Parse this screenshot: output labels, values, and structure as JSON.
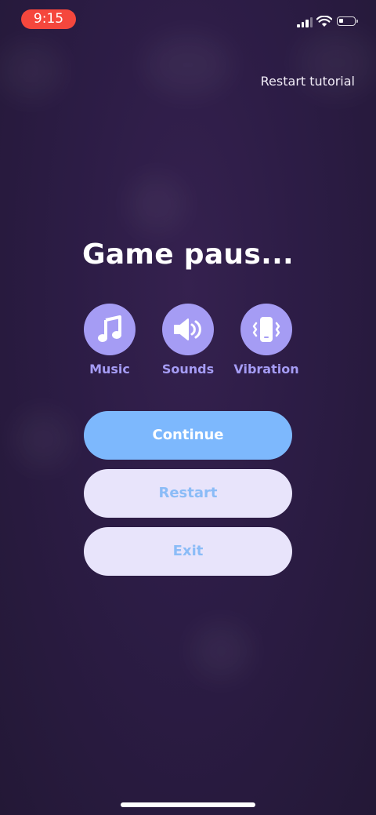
{
  "status_bar": {
    "time": "9:15",
    "time_pill_color": "#f5473d",
    "icons": [
      "cellular-signal-icon",
      "wifi-icon",
      "battery-icon"
    ]
  },
  "header": {
    "restart_tutorial": "Restart tutorial"
  },
  "pause_menu": {
    "title": "Game paus...",
    "toggles": [
      {
        "label": "Music",
        "icon": "music-note-icon"
      },
      {
        "label": "Sounds",
        "icon": "speaker-icon"
      },
      {
        "label": "Vibration",
        "icon": "phone-vibrate-icon"
      }
    ],
    "buttons": {
      "continue": "Continue",
      "restart": "Restart",
      "exit": "Exit"
    }
  },
  "colors": {
    "background": "#2c1c45",
    "toggle_accent": "#a59cf4",
    "primary_button": "#7db8fd",
    "secondary_button": "#e8e4fb",
    "secondary_button_text": "#8bbcf7"
  }
}
